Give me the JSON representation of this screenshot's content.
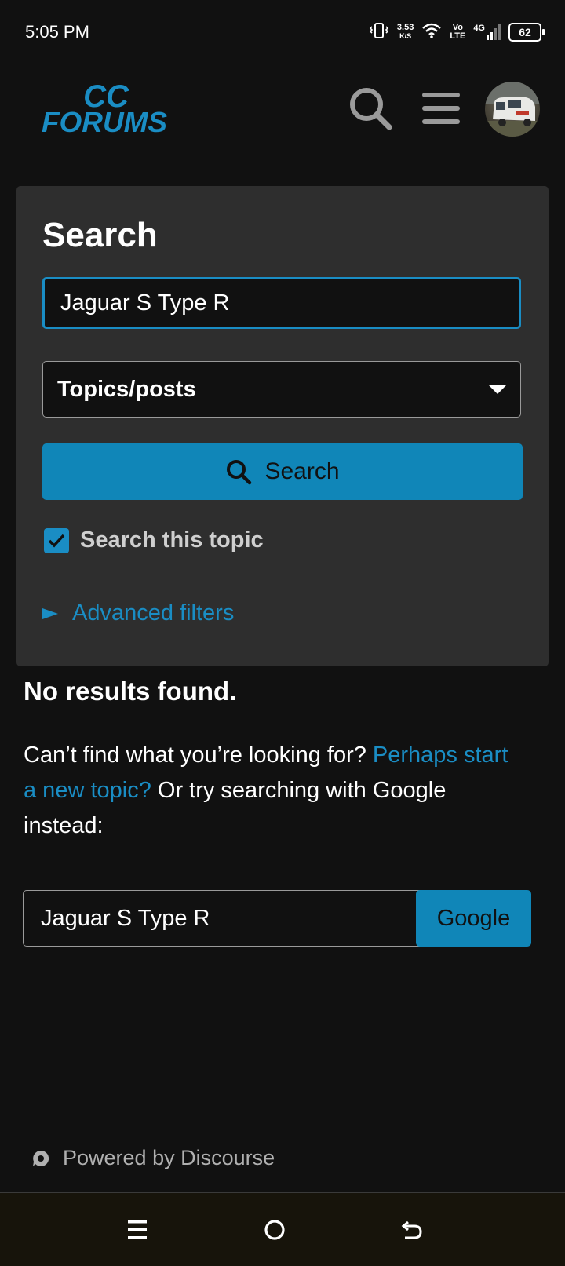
{
  "status_bar": {
    "time": "5:05 PM",
    "net_speed_value": "3.53",
    "net_speed_unit": "K/S",
    "volte_top": "Vo",
    "volte_bottom": "LTE",
    "network": "4G",
    "battery": "62",
    "battery_level": 0.62
  },
  "header": {
    "logo_top": "CC",
    "logo_bottom": "FORUMS",
    "brand_color": "#1a8dc4",
    "icons": [
      "search-icon",
      "hamburger-menu-icon",
      "user-avatar"
    ]
  },
  "search_panel": {
    "title": "Search",
    "term_value": "Jaguar S Type R",
    "type_selected": "Topics/posts",
    "search_button_label": "Search",
    "search_this_topic_label": "Search this topic",
    "search_this_topic_checked": true,
    "advanced_filters_label": "Advanced filters"
  },
  "results": {
    "no_results_heading": "No results found.",
    "help_prefix": "Can’t find what you’re looking for?",
    "help_link": "Perhaps start a new topic?",
    "help_suffix": "Or try searching with Google instead:",
    "google_query_value": "Jaguar S Type R",
    "google_button_label": "Google"
  },
  "footer": {
    "powered_by": "Powered by Discourse"
  },
  "nav_bar": {
    "icons": [
      "recents-icon",
      "home-icon",
      "back-icon"
    ]
  }
}
